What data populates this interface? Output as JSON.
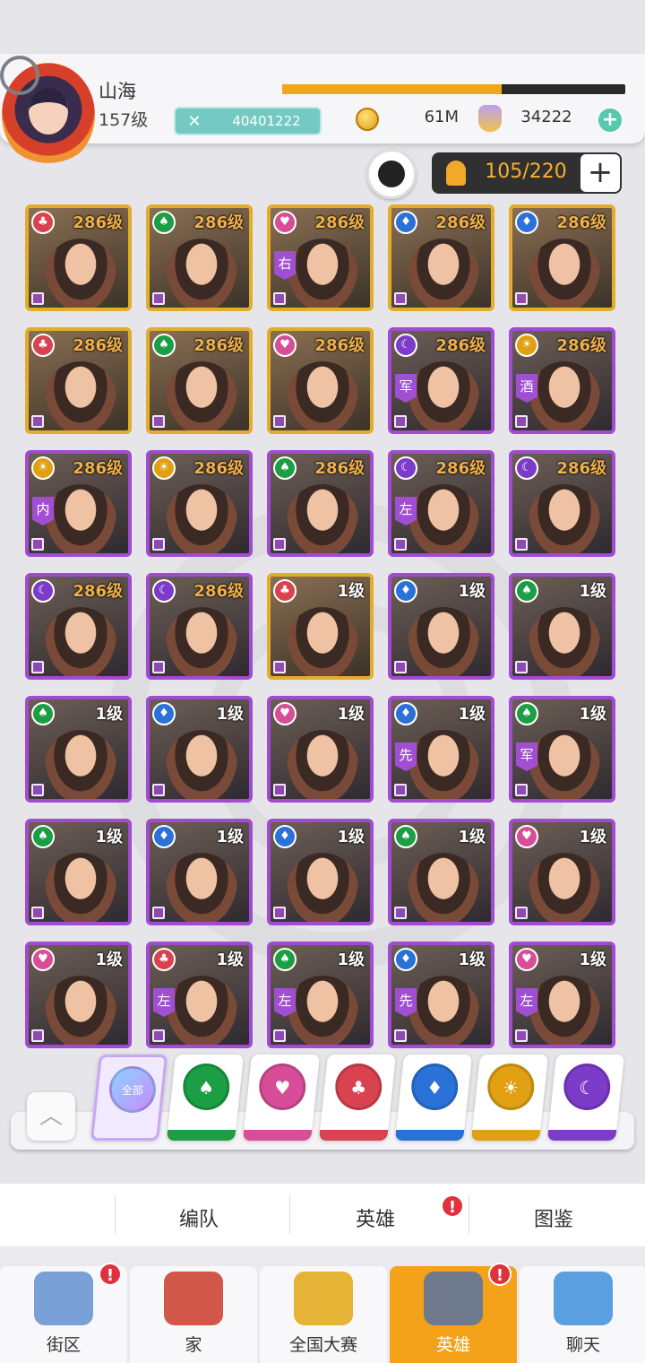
{
  "player": {
    "name": "山海",
    "level": "157级",
    "power": "40401222",
    "xp_progress": 0.64
  },
  "currency": {
    "coins": "61M",
    "gems": "34222"
  },
  "capacity": "105/220",
  "hero_grid": [
    {
      "suit": "red",
      "symbol": "♣",
      "level": "286级",
      "frame": "gold",
      "role": ""
    },
    {
      "suit": "green",
      "symbol": "♠",
      "level": "286级",
      "frame": "gold",
      "role": ""
    },
    {
      "suit": "pink",
      "symbol": "♥",
      "level": "286级",
      "frame": "gold",
      "role": "右"
    },
    {
      "suit": "blue",
      "symbol": "♦",
      "level": "286级",
      "frame": "gold",
      "role": ""
    },
    {
      "suit": "blue",
      "symbol": "♦",
      "level": "286级",
      "frame": "gold",
      "role": ""
    },
    {
      "suit": "red",
      "symbol": "♣",
      "level": "286级",
      "frame": "gold",
      "role": ""
    },
    {
      "suit": "green",
      "symbol": "♠",
      "level": "286级",
      "frame": "gold",
      "role": ""
    },
    {
      "suit": "pink",
      "symbol": "♥",
      "level": "286级",
      "frame": "gold",
      "role": ""
    },
    {
      "suit": "purple",
      "symbol": "☾",
      "level": "286级",
      "frame": "purple",
      "role": "军"
    },
    {
      "suit": "yellow",
      "symbol": "☀",
      "level": "286级",
      "frame": "purple",
      "role": "酒"
    },
    {
      "suit": "yellow",
      "symbol": "☀",
      "level": "286级",
      "frame": "purple",
      "role": "内"
    },
    {
      "suit": "yellow",
      "symbol": "☀",
      "level": "286级",
      "frame": "purple",
      "role": ""
    },
    {
      "suit": "green",
      "symbol": "♠",
      "level": "286级",
      "frame": "purple",
      "role": ""
    },
    {
      "suit": "purple",
      "symbol": "☾",
      "level": "286级",
      "frame": "purple",
      "role": "左"
    },
    {
      "suit": "purple",
      "symbol": "☾",
      "level": "286级",
      "frame": "purple",
      "role": ""
    },
    {
      "suit": "purple",
      "symbol": "☾",
      "level": "286级",
      "frame": "purple",
      "role": ""
    },
    {
      "suit": "purple",
      "symbol": "☾",
      "level": "286级",
      "frame": "purple",
      "role": ""
    },
    {
      "suit": "red",
      "symbol": "♣",
      "level": "1级",
      "frame": "gold",
      "role": ""
    },
    {
      "suit": "blue",
      "symbol": "♦",
      "level": "1级",
      "frame": "purple",
      "role": ""
    },
    {
      "suit": "green",
      "symbol": "♠",
      "level": "1级",
      "frame": "purple",
      "role": ""
    },
    {
      "suit": "green",
      "symbol": "♠",
      "level": "1级",
      "frame": "purple",
      "role": ""
    },
    {
      "suit": "blue",
      "symbol": "♦",
      "level": "1级",
      "frame": "purple",
      "role": ""
    },
    {
      "suit": "pink",
      "symbol": "♥",
      "level": "1级",
      "frame": "purple",
      "role": ""
    },
    {
      "suit": "blue",
      "symbol": "♦",
      "level": "1级",
      "frame": "purple",
      "role": "先"
    },
    {
      "suit": "green",
      "symbol": "♠",
      "level": "1级",
      "frame": "purple",
      "role": "军"
    },
    {
      "suit": "green",
      "symbol": "♠",
      "level": "1级",
      "frame": "purple",
      "role": ""
    },
    {
      "suit": "blue",
      "symbol": "♦",
      "level": "1级",
      "frame": "purple",
      "role": ""
    },
    {
      "suit": "blue",
      "symbol": "♦",
      "level": "1级",
      "frame": "purple",
      "role": ""
    },
    {
      "suit": "green",
      "symbol": "♠",
      "level": "1级",
      "frame": "purple",
      "role": ""
    },
    {
      "suit": "pink",
      "symbol": "♥",
      "level": "1级",
      "frame": "purple",
      "role": ""
    },
    {
      "suit": "pink",
      "symbol": "♥",
      "level": "1级",
      "frame": "purple",
      "role": ""
    },
    {
      "suit": "red",
      "symbol": "♣",
      "level": "1级",
      "frame": "purple",
      "role": "左"
    },
    {
      "suit": "green",
      "symbol": "♠",
      "level": "1级",
      "frame": "purple",
      "role": "左"
    },
    {
      "suit": "blue",
      "symbol": "♦",
      "level": "1级",
      "frame": "purple",
      "role": "先"
    },
    {
      "suit": "pink",
      "symbol": "♥",
      "level": "1级",
      "frame": "purple",
      "role": "左"
    }
  ],
  "filters": [
    {
      "id": "all",
      "label": "全部",
      "color": "#b58cf0",
      "icon": "cards-icon"
    },
    {
      "id": "green",
      "color": "#1c9e44",
      "symbol": "♠"
    },
    {
      "id": "pink",
      "color": "#d84d98",
      "symbol": "♥"
    },
    {
      "id": "red",
      "color": "#d8434f",
      "symbol": "♣"
    },
    {
      "id": "blue",
      "color": "#2a72d8",
      "symbol": "♦"
    },
    {
      "id": "yellow",
      "color": "#e0a012",
      "symbol": "☀"
    },
    {
      "id": "purple",
      "color": "#7c3bc8",
      "symbol": "☾"
    }
  ],
  "subtabs": {
    "formation": "编队",
    "heroes": "英雄",
    "codex": "图鉴",
    "badge": "!"
  },
  "nav": [
    {
      "label": "街区",
      "badge": "!",
      "icon": "signpost-icon",
      "color": "#7aa0d8"
    },
    {
      "label": "家",
      "badge": "",
      "icon": "house-icon",
      "color": "#d0574a"
    },
    {
      "label": "全国大赛",
      "badge": "",
      "icon": "trophy-icon",
      "color": "#e5b436"
    },
    {
      "label": "英雄",
      "badge": "!",
      "icon": "hero-cards-icon",
      "color": "#6f7a8c",
      "active": true
    },
    {
      "label": "聊天",
      "badge": "",
      "icon": "chat-bubble-icon",
      "color": "#5aa0e0"
    }
  ]
}
